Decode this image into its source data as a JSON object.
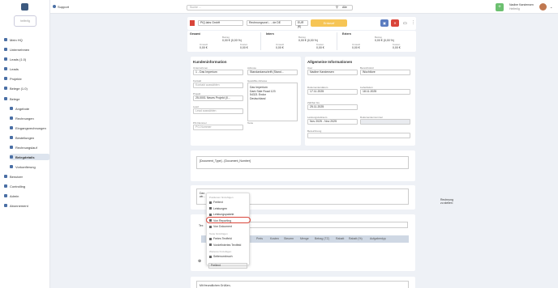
{
  "app": {
    "title": "Support"
  },
  "search": {
    "placeholder": "Suche ...",
    "scope": "Alle"
  },
  "user": {
    "name": "Nadine Karstensen",
    "company": "Helferlig"
  },
  "company_box": "helferlig",
  "sidebar": {
    "items": [
      {
        "label": "Mein HQ",
        "sub": false
      },
      {
        "label": "Unternehmen",
        "sub": false
      },
      {
        "label": "Leads (1.0)",
        "sub": false
      },
      {
        "label": "Leads",
        "sub": false
      },
      {
        "label": "Projekte",
        "sub": false
      },
      {
        "label": "Belege (1.0)",
        "sub": false
      },
      {
        "label": "Belege",
        "sub": false
      },
      {
        "label": "Angebote",
        "sub": true
      },
      {
        "label": "Rechnungen",
        "sub": true
      },
      {
        "label": "Eingangsrechnungen",
        "sub": true
      },
      {
        "label": "Bestellungen",
        "sub": true
      },
      {
        "label": "Rechnungslauf",
        "sub": true
      },
      {
        "label": "Belegdetails",
        "sub": true,
        "active": true
      },
      {
        "label": "Vorkonfierung",
        "sub": true
      },
      {
        "label": "Benutzer",
        "sub": false
      },
      {
        "label": "Controlling",
        "sub": false
      },
      {
        "label": "Admin",
        "sub": false
      },
      {
        "label": "Abonnement",
        "sub": false
      }
    ]
  },
  "doc_header": {
    "company": "PiQ.labs GmbH",
    "doc_type": "Rechnungsvorl... - de DE",
    "currency": "EUR (€)",
    "status": "Entwurf"
  },
  "summary": {
    "gesamt": {
      "title": "Gesamt",
      "betrag_label": "Betrag",
      "betrag": "0,00 € (0,00 %)",
      "cols": [
        "Umsatz",
        "Kosten"
      ],
      "vals": [
        "0,00 €",
        "0,00 €"
      ]
    },
    "intern": {
      "title": "Intern",
      "betrag_label": "Betrag",
      "betrag": "0,00 € (0,00 %)",
      "cols": [
        "Umsatz",
        "Kosten"
      ],
      "vals": [
        "0,00 €",
        "0,00 €"
      ]
    },
    "extern": {
      "title": "Extern",
      "betrag_label": "Betrag",
      "betrag": "0,00 € (0,00 %)",
      "cols": [
        "Umsatz",
        "Kosten"
      ],
      "vals": [
        "0,00 €",
        "0,00 €"
      ]
    }
  },
  "kunden": {
    "title": "Kundeninformation",
    "unternehmen_label": "Unternehmen",
    "unternehmen": "1 - Das Imperium",
    "adresse_label": "Adresse",
    "adresse": "Standardanschrift (Stand...",
    "kontakt_label": "Kontakt",
    "kontakt": "Kontakt auswählen",
    "projekt_label": "Projekt",
    "projekt": "25-0001 Neues Projekt (0...",
    "lead_label": "Lead",
    "lead": "Lead auswählen",
    "po_label": "PO-Nummer",
    "po": "PO-Nummer",
    "gew_label": "Gewählte Adresse",
    "address_lines": [
      "Das Imperium",
      "Dark Side Road 123",
      "54321 Endor",
      "Deutschland"
    ],
    "texte_label": "Texte"
  },
  "allgemein": {
    "title": "Allgemeine Informationen",
    "user_label": "User",
    "user": "Nadine Karstensen",
    "bereich_label": "Bereichsfeld",
    "bereich": "Wochtlore",
    "datum_label": "Dokumentendatum",
    "datum": "17.11.2025",
    "liefer_label": "Lieferdatum",
    "liefer": "18.11.2025",
    "zahl_label": "Zahlbar bis",
    "zahl": "25.11.2025",
    "zeit_label": "Leistungszeitraum",
    "zeit": "Nov 2025 - Nov 2025",
    "nummer_label": "Dokumentennummer",
    "bez_label": "Bezeichnung"
  },
  "doc_placeholder": "[Document_Type] - [Document_Number]",
  "block2": {
    "title_partial": "Dan",
    "line": "wir...",
    "tail": "Rechnung zu stellen:"
  },
  "table_section": {
    "label_partial": "Tex"
  },
  "table_headers": [
    "Preis",
    "Kosten",
    "Steuern",
    "Menge",
    "Betrag (TZ)",
    "Rabatt",
    "Rabatt (%)",
    "Aufgabentyp"
  ],
  "context_menu": {
    "groups": [
      {
        "title": "Positionen hinzufügen",
        "items": [
          "Freitext",
          "Leistungen",
          "Leistungspakete",
          "Von Reporting",
          "Von Dokument"
        ]
      },
      {
        "title": "Texte hinzufügen",
        "items": [
          "Freies Textfeld",
          "Vordefiniertes Textfeld"
        ]
      },
      {
        "title": "Weiteres hinzufügen",
        "items": [
          "Seitenumbruch"
        ]
      }
    ],
    "footer": "Freitext",
    "highlighted": "Von Reporting"
  },
  "footer_text": "Mit freundlichen Grüßen,",
  "colors": {
    "highlight": "#d9453a",
    "accent": "#4a6fa5",
    "status": "#f6c555"
  }
}
